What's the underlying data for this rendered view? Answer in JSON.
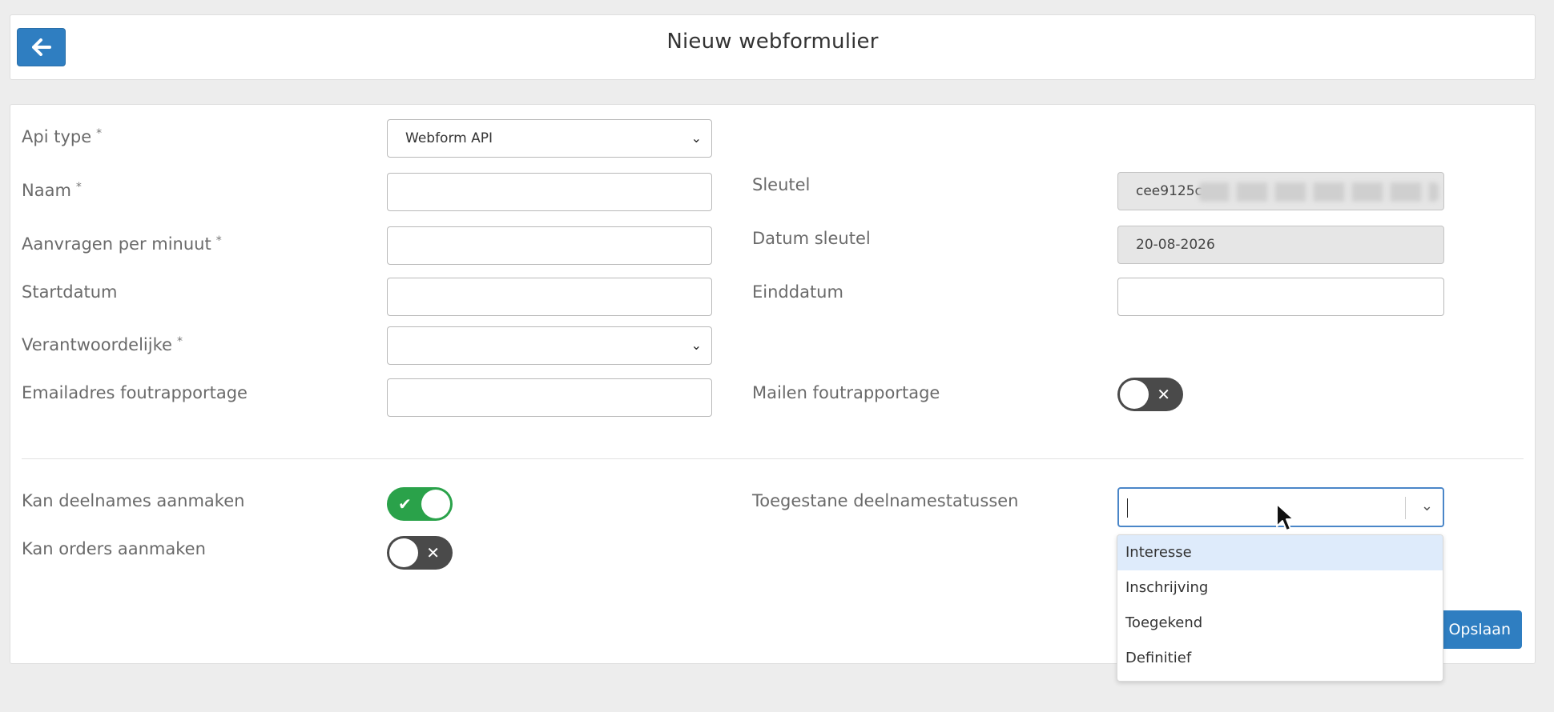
{
  "header": {
    "title": "Nieuw webformulier"
  },
  "form": {
    "api_type": {
      "label": "Api type",
      "required_mark": "*",
      "value": "Webform API"
    },
    "naam": {
      "label": "Naam",
      "required_mark": "*",
      "value": ""
    },
    "aanvragen": {
      "label": "Aanvragen per minuut",
      "required_mark": "*",
      "value": ""
    },
    "startdatum": {
      "label": "Startdatum",
      "value": ""
    },
    "verantwoordelijke": {
      "label": "Verantwoordelijke",
      "required_mark": "*",
      "value": ""
    },
    "emailadres": {
      "label": "Emailadres foutrapportage",
      "value": ""
    },
    "sleutel": {
      "label": "Sleutel",
      "value": "cee9125c"
    },
    "datum_sleutel": {
      "label": "Datum sleutel",
      "value": "20-08-2026"
    },
    "einddatum": {
      "label": "Einddatum",
      "value": ""
    },
    "mailen": {
      "label": "Mailen foutrapportage",
      "state": "off"
    },
    "deelnames": {
      "label": "Kan deelnames aanmaken",
      "state": "on"
    },
    "orders": {
      "label": "Kan orders aanmaken",
      "state": "off"
    },
    "statussen": {
      "label": "Toegestane deelnamestatussen",
      "value": "",
      "options": [
        "Interesse",
        "Inschrijving",
        "Toegekend",
        "Definitief"
      ],
      "highlighted": "Interesse"
    }
  },
  "actions": {
    "save_label": "Opslaan"
  },
  "colors": {
    "primary": "#2f7ec1",
    "toggle_on": "#2aa24a",
    "toggle_off": "#4a4a4a"
  }
}
